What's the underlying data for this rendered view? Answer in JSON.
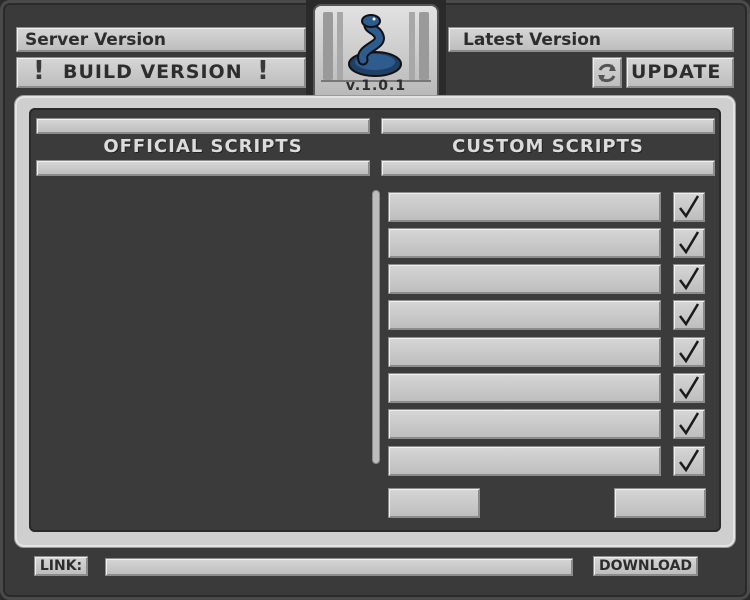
{
  "header": {
    "server_version_label": "Server Version",
    "build_version_label": "BUILD VERSION",
    "build_version_marks": [
      "!",
      "!"
    ],
    "latest_version_label": "Latest Version",
    "update_label": "UPDATE",
    "refresh_icon": "refresh-icon"
  },
  "logo": {
    "icon": "snake-logo-icon",
    "version": "v.1.0.1",
    "color": "#2e5c8f"
  },
  "panels": {
    "official_title": "OFFICIAL SCRIPTS",
    "custom_title": "CUSTOM SCRIPTS"
  },
  "custom_scripts": [
    {
      "name": "",
      "checked": true
    },
    {
      "name": "",
      "checked": true
    },
    {
      "name": "",
      "checked": true
    },
    {
      "name": "",
      "checked": true
    },
    {
      "name": "",
      "checked": true
    },
    {
      "name": "",
      "checked": true
    },
    {
      "name": "",
      "checked": true
    },
    {
      "name": "",
      "checked": true
    }
  ],
  "footer": {
    "link_label": "LINK:",
    "link_value": "",
    "download_label": "DOWNLOAD"
  },
  "colors": {
    "background": "#3a3a3a",
    "panel": "#cfcfcf",
    "bar": "#c8c8c8",
    "text_dark": "#2d2d2d",
    "text_light": "#dcdcdc"
  }
}
